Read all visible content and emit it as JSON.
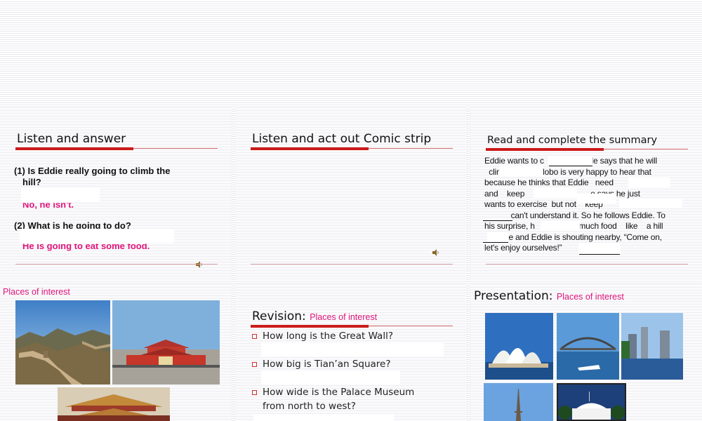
{
  "slide1": {
    "title": "Listen and answer",
    "q1": "(1) Is Eddie really going to climb the",
    "q1_cont": "hill?",
    "a1": "No, he isn't.",
    "q2": "(2) What is he going to do?",
    "a2": "He is going to eat some food."
  },
  "slide2": {
    "title": "Listen and act out Comic strip"
  },
  "slide3": {
    "title": "Read and complete the summary",
    "lines": [
      "Eddie wants to c            day. He says that he will",
      "  clir                  Hobo is very happy to hear that",
      "because he thinks that Eddie   need              nat",
      "and    keep                              e says he just",
      "wants to exercise  but not    keep",
      "            can't understand it. So he follows Eddie. To",
      "his surprise, h                    much food    like    a hill",
      "           e and Eddie is shouting nearby, “Come on,",
      "let's enjoy ourselves!”"
    ]
  },
  "slide4": {
    "title": "Places of interest"
  },
  "slide5": {
    "title": "Revision:",
    "subtitle": "Places of interest",
    "items": [
      "How long is the Great Wall?",
      "How big is Tian’an Square?",
      "How wide is  the Palace Museum",
      "from north to west?"
    ]
  },
  "slide6": {
    "title": "Presentation:",
    "subtitle": "Places of interest"
  },
  "colors": {
    "accent_red": "#cc1a1a",
    "answer_pink": "#e0157a"
  },
  "icons": [
    "speaker-icon"
  ]
}
